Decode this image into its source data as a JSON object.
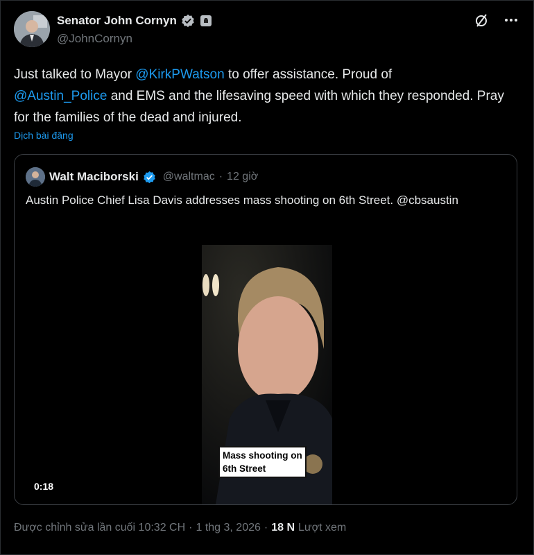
{
  "author": {
    "display_name": "Senator John Cornyn",
    "handle": "@JohnCornyn",
    "verified_icon": "verified-badge-icon",
    "gov_icon": "government-badge-icon"
  },
  "actions": {
    "grok_icon": "slash-circle-icon",
    "more_icon": "more-dots-icon"
  },
  "tweet": {
    "text_parts": [
      "Just talked to Mayor ",
      "@KirkPWatson",
      " to offer assistance. Proud of ",
      "@Austin_Police",
      " and EMS and the lifesaving speed with which they responded.  Pray for the families of the dead and injured."
    ],
    "translate_label": "Dịch bài đăng"
  },
  "quote": {
    "name": "Walt Maciborski",
    "handle": "@waltmac",
    "separator": "·",
    "time": "12 giờ",
    "text": "Austin Police Chief Lisa Davis addresses mass shooting on 6th Street. @cbsaustin",
    "video": {
      "caption_line1": "Mass shooting on",
      "caption_line2": "6th Street",
      "duration": "0:18"
    }
  },
  "footer": {
    "edited": "Được chỉnh sửa lần cuối 10:32 CH",
    "sep1": "·",
    "date": "1 thg 3, 2026",
    "sep2": "·",
    "views_count": "18 N",
    "views_label": "Lượt xem"
  },
  "colors": {
    "accent": "#1d9bf0",
    "background": "#000000",
    "muted": "#71767b"
  }
}
